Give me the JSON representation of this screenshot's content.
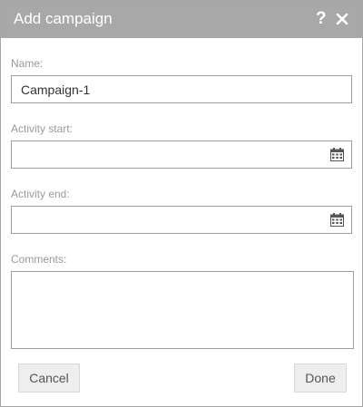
{
  "dialog": {
    "title": "Add campaign",
    "help_icon": "help-icon",
    "close_icon": "close-icon"
  },
  "form": {
    "name": {
      "label": "Name:",
      "value": "Campaign-1"
    },
    "activity_start": {
      "label": "Activity start:",
      "value": "",
      "icon": "calendar-icon"
    },
    "activity_end": {
      "label": "Activity end:",
      "value": "",
      "icon": "calendar-icon"
    },
    "comments": {
      "label": "Comments:",
      "value": ""
    }
  },
  "buttons": {
    "cancel": "Cancel",
    "done": "Done"
  },
  "colors": {
    "titlebar": "#a8a8a8",
    "label": "#9a9a9a",
    "button_bg": "#eeeeee",
    "icon": "#555555"
  }
}
